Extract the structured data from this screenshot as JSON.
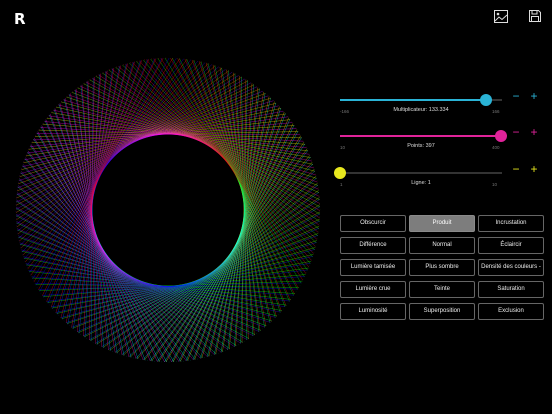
{
  "app": {
    "logo": "R"
  },
  "toolbar": {
    "image_icon": "image-icon",
    "save_icon": "save-icon"
  },
  "colors": {
    "multiplier_accent": "#2ab3d6",
    "points_accent": "#e0239a",
    "line_accent": "#e8e81e",
    "selected_button": "#7d7d7d"
  },
  "sliders": {
    "multiplier": {
      "min_label": "-166",
      "max_label": "166",
      "caption": "Multiplicateur: 133.334",
      "value": 133.334,
      "min": -166,
      "max": 166,
      "minus": "−",
      "plus": "+"
    },
    "points": {
      "min_label": "10",
      "max_label": "400",
      "caption": "Points: 397",
      "value": 397,
      "min": 10,
      "max": 400,
      "minus": "−",
      "plus": "+"
    },
    "line": {
      "min_label": "1",
      "max_label": "10",
      "caption": "Ligne: 1",
      "value": 1,
      "min": 1,
      "max": 10,
      "minus": "−",
      "plus": "+"
    }
  },
  "blend_modes": {
    "selected": "Produit",
    "items": [
      "Obscurcir",
      "Produit",
      "Incrustation",
      "Différence",
      "Normal",
      "Éclaircir",
      "Lumière tamisée",
      "Plus sombre",
      "Densité des couleurs -",
      "Lumière crue",
      "Teinte",
      "Saturation",
      "Luminosité",
      "Superposition",
      "Exclusion"
    ]
  }
}
